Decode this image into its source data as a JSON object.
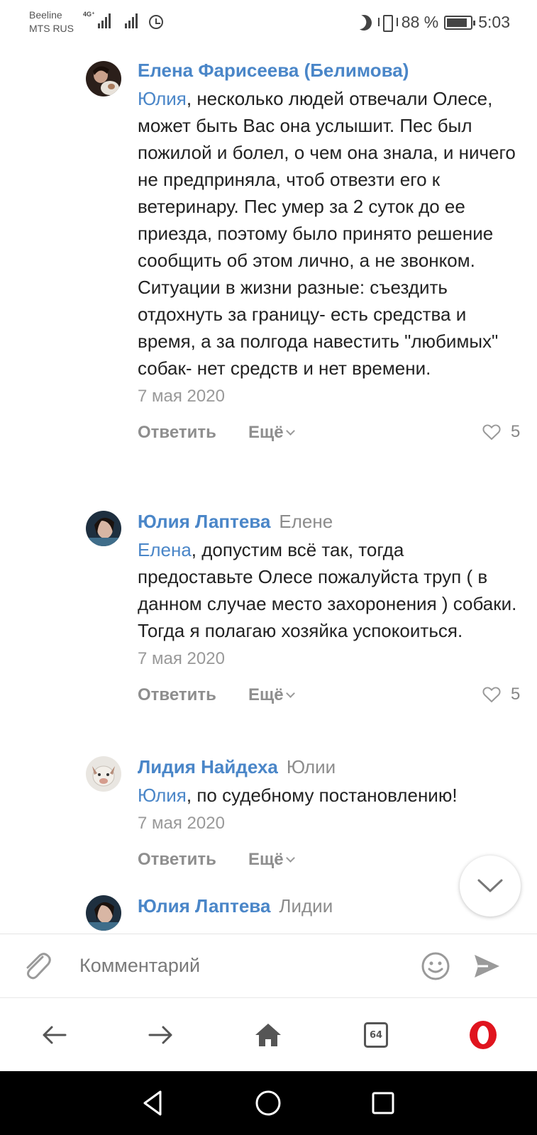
{
  "status_bar": {
    "carrier_1": "Beeline",
    "carrier_2": "MTS RUS",
    "network": "4G⁺",
    "battery": "88 %",
    "battery_level": 0.88,
    "time": "5:03"
  },
  "comments": [
    {
      "author": "Елена Фарисеева (Белимова)",
      "reply_to": "",
      "mention": "Юлия",
      "text": ", несколько людей отвечали Олесе, может быть Вас она услышит. Пес был пожилой и болел, о чем она знала, и ничего не предприняла, чтоб отвезти его к ветеринару. Пес умер за 2 суток до ее приезда, поэтому было принято решение сообщить об этом лично, а не звонком.\nСитуации в жизни разные: съездить отдохнуть за границу- есть средства и время, а за полгода навестить \"любимых\" собак- нет средств и нет времени.",
      "date": "7 мая 2020",
      "reply_label": "Ответить",
      "more_label": "Ещё",
      "likes": "5"
    },
    {
      "author": "Юлия Лаптева",
      "reply_to": "Елене",
      "mention": "Елена",
      "text": ", допустим всё так, тогда предоставьте Олесе пожалуйста труп ( в данном случае место захоронения ) собаки. Тогда я полагаю хозяйка успокоиться.",
      "date": "7 мая 2020",
      "reply_label": "Ответить",
      "more_label": "Ещё",
      "likes": "5"
    },
    {
      "author": "Лидия Найдеха",
      "reply_to": "Юлии",
      "mention": "Юлия",
      "text": ", по судебному постановлению!",
      "date": "7 мая 2020",
      "reply_label": "Ответить",
      "more_label": "Ещё",
      "likes": ""
    },
    {
      "author": "Юлия Лаптева",
      "reply_to": "Лидии"
    }
  ],
  "composer": {
    "placeholder": "Комментарий"
  },
  "browser_bar": {
    "tab_count": "64"
  },
  "colors": {
    "link": "#4a86c8",
    "meta": "#8e8e8e",
    "opera": "#e0141e"
  },
  "icons": [
    "attach-icon",
    "emoji-icon",
    "send-icon",
    "back-arrow-icon",
    "forward-arrow-icon",
    "home-icon",
    "tabs-icon",
    "opera-icon",
    "chevron-down-icon",
    "heart-icon"
  ]
}
